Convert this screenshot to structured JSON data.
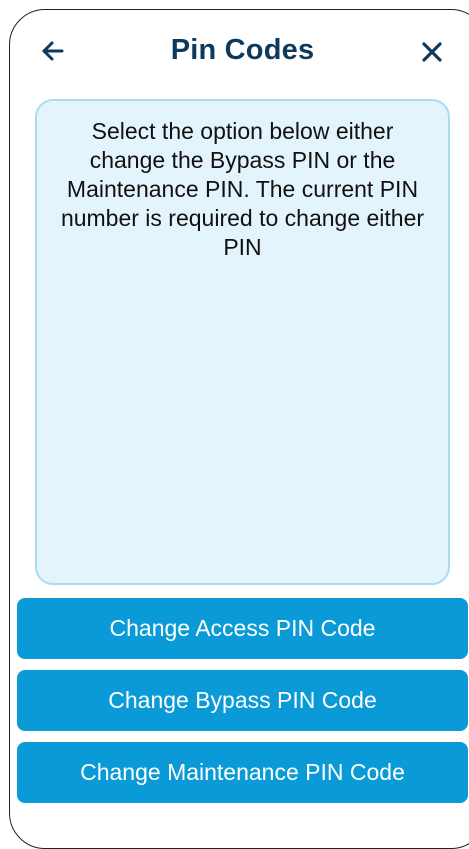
{
  "header": {
    "title": "Pin Codes",
    "back_icon": "arrow-left-icon",
    "close_icon": "close-icon"
  },
  "info": {
    "text": "Select the option below either change the Bypass PIN or the Maintenance PIN. The current PIN number is required to change either PIN"
  },
  "actions": {
    "access_label": "Change Access PIN Code",
    "bypass_label": "Change Bypass PIN Code",
    "maintenance_label": "Change Maintenance PIN Code"
  },
  "colors": {
    "title": "#0d3a5c",
    "button": "#0a9ad8",
    "info_bg": "#e4f4fc",
    "info_border": "#a9dcf2"
  }
}
